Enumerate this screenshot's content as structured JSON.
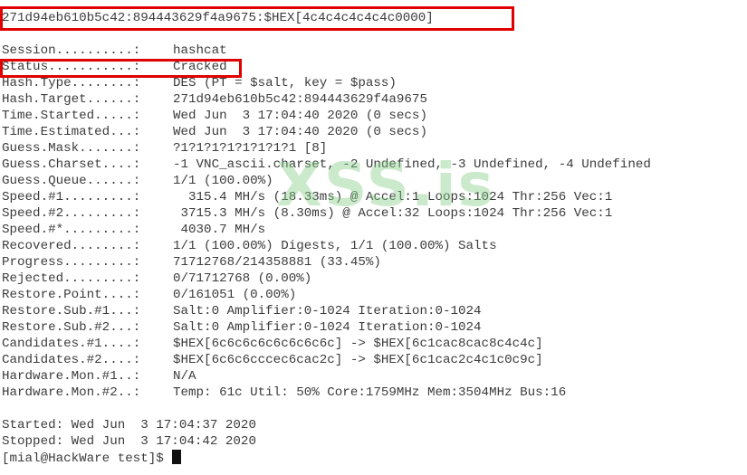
{
  "window": {
    "background": "#ffffff",
    "highlight_color": "#e00000"
  },
  "hash_line": "271d94eb610b5c42:894443629f4a9675:$HEX[4c4c4c4c4c4c0000]",
  "stats": [
    {
      "key": "Session..........:",
      "value": "hashcat"
    },
    {
      "key": "Status...........:",
      "value": "Cracked"
    },
    {
      "key": "Hash.Type........:",
      "value": "DES (PT = $salt, key = $pass)"
    },
    {
      "key": "Hash.Target......:",
      "value": "271d94eb610b5c42:894443629f4a9675"
    },
    {
      "key": "Time.Started.....:",
      "value": "Wed Jun  3 17:04:40 2020 (0 secs)"
    },
    {
      "key": "Time.Estimated...:",
      "value": "Wed Jun  3 17:04:40 2020 (0 secs)"
    },
    {
      "key": "Guess.Mask.......:",
      "value": "?1?1?1?1?1?1?1?1 [8]"
    },
    {
      "key": "Guess.Charset....:",
      "value": "-1 VNC_ascii.charset, -2 Undefined, -3 Undefined, -4 Undefined"
    },
    {
      "key": "Guess.Queue......:",
      "value": "1/1 (100.00%)"
    },
    {
      "key": "Speed.#1.........:",
      "value": "  315.4 MH/s (18.33ms) @ Accel:1 Loops:1024 Thr:256 Vec:1"
    },
    {
      "key": "Speed.#2.........:",
      "value": " 3715.3 MH/s (8.30ms) @ Accel:32 Loops:1024 Thr:256 Vec:1"
    },
    {
      "key": "Speed.#*.........:",
      "value": " 4030.7 MH/s"
    },
    {
      "key": "Recovered........:",
      "value": "1/1 (100.00%) Digests, 1/1 (100.00%) Salts"
    },
    {
      "key": "Progress.........:",
      "value": "71712768/214358881 (33.45%)"
    },
    {
      "key": "Rejected.........:",
      "value": "0/71712768 (0.00%)"
    },
    {
      "key": "Restore.Point....:",
      "value": "0/161051 (0.00%)"
    },
    {
      "key": "Restore.Sub.#1...:",
      "value": "Salt:0 Amplifier:0-1024 Iteration:0-1024"
    },
    {
      "key": "Restore.Sub.#2...:",
      "value": "Salt:0 Amplifier:0-1024 Iteration:0-1024"
    },
    {
      "key": "Candidates.#1....:",
      "value": "$HEX[6c6c6c6c6c6c6c6c] -> $HEX[6c1cac8cac8c4c4c]"
    },
    {
      "key": "Candidates.#2....:",
      "value": "$HEX[6c6c6cccec6cac2c] -> $HEX[6c1cac2c4c1c0c9c]"
    },
    {
      "key": "Hardware.Mon.#1..:",
      "value": "N/A"
    },
    {
      "key": "Hardware.Mon.#2..:",
      "value": "Temp: 61c Util: 50% Core:1759MHz Mem:3504MHz Bus:16"
    }
  ],
  "started_line": "Started: Wed Jun  3 17:04:37 2020",
  "stopped_line": "Stopped: Wed Jun  3 17:04:42 2020",
  "prompt": "[mial@HackWare test]$",
  "watermark": "XSS.is"
}
